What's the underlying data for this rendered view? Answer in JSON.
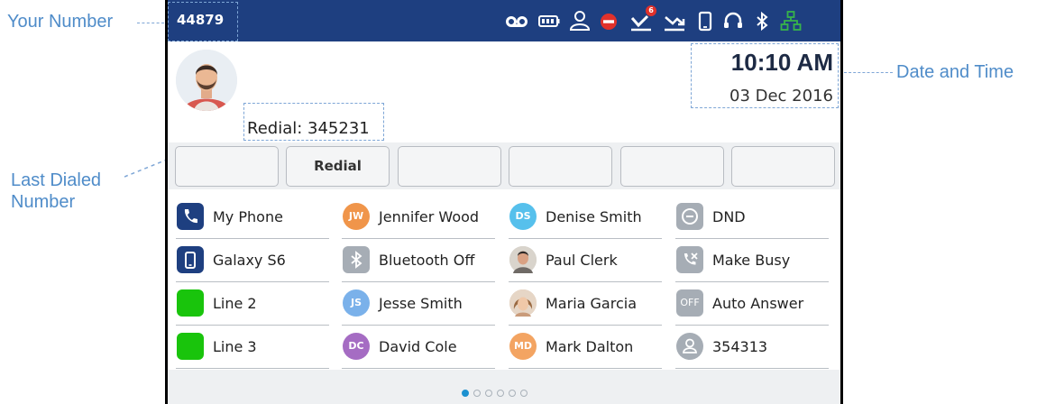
{
  "callouts": {
    "your_number": "Your Number",
    "date_time": "Date and Time",
    "last_dialed_line1": "Last Dialed",
    "last_dialed_line2": "Number"
  },
  "status_bar": {
    "number": "44879",
    "missed_calls_count": "6",
    "icons": [
      "voicemail-icon",
      "battery-icon",
      "user-presence-icon",
      "dnd-status-icon",
      "missed-calls-icon",
      "call-forward-icon",
      "mobile-device-icon",
      "headset-icon",
      "bluetooth-icon",
      "network-icon"
    ],
    "colors": {
      "bar": "#1e3f80",
      "dnd": "#e0312b",
      "network": "#37b44a"
    }
  },
  "clock": {
    "time": "10:10 AM",
    "date": "03 Dec 2016"
  },
  "redial_label": "Redial: 345231",
  "softkeys": [
    "",
    "Redial",
    "",
    "",
    "",
    ""
  ],
  "favorites": [
    [
      {
        "label": "My Phone",
        "icon": "phone-icon",
        "badge": "",
        "color": "#1e3f80"
      },
      {
        "label": "Galaxy S6",
        "icon": "mobile-icon",
        "badge": "",
        "color": "#1e3f80"
      },
      {
        "label": "Line 2",
        "icon": "line-status",
        "badge": "",
        "color": "#19c40c"
      },
      {
        "label": "Line 3",
        "icon": "line-status",
        "badge": "",
        "color": "#19c40c"
      }
    ],
    [
      {
        "label": "Jennifer Wood",
        "icon": "initials",
        "badge": "JW",
        "color": "#f0954a"
      },
      {
        "label": "Bluetooth Off",
        "icon": "bluetooth-icon",
        "badge": "",
        "color": "#a6adb5"
      },
      {
        "label": "Jesse Smith",
        "icon": "initials",
        "badge": "JS",
        "color": "#7ab1ea"
      },
      {
        "label": "David Cole",
        "icon": "initials",
        "badge": "DC",
        "color": "#a56cc3"
      }
    ],
    [
      {
        "label": "Denise Smith",
        "icon": "initials",
        "badge": "DS",
        "color": "#56c0ec"
      },
      {
        "label": "Paul Clerk",
        "icon": "photo",
        "badge": "",
        "color": "#c9c4bc"
      },
      {
        "label": "Maria Garcia",
        "icon": "photo",
        "badge": "",
        "color": "#d7b79a"
      },
      {
        "label": "Mark Dalton",
        "icon": "initials",
        "badge": "MD",
        "color": "#f3a462"
      }
    ],
    [
      {
        "label": "DND",
        "icon": "dnd-icon",
        "badge": "",
        "color": "#a6adb5"
      },
      {
        "label": "Make Busy",
        "icon": "make-busy-icon",
        "badge": "",
        "color": "#a6adb5"
      },
      {
        "label": "Auto Answer",
        "icon": "auto-answer-icon",
        "badge": "OFF",
        "color": "#a6adb5"
      },
      {
        "label": "354313",
        "icon": "contact-icon",
        "badge": "",
        "color": "#a6adb5"
      }
    ]
  ],
  "pager": {
    "pages": 6,
    "active": 1
  }
}
